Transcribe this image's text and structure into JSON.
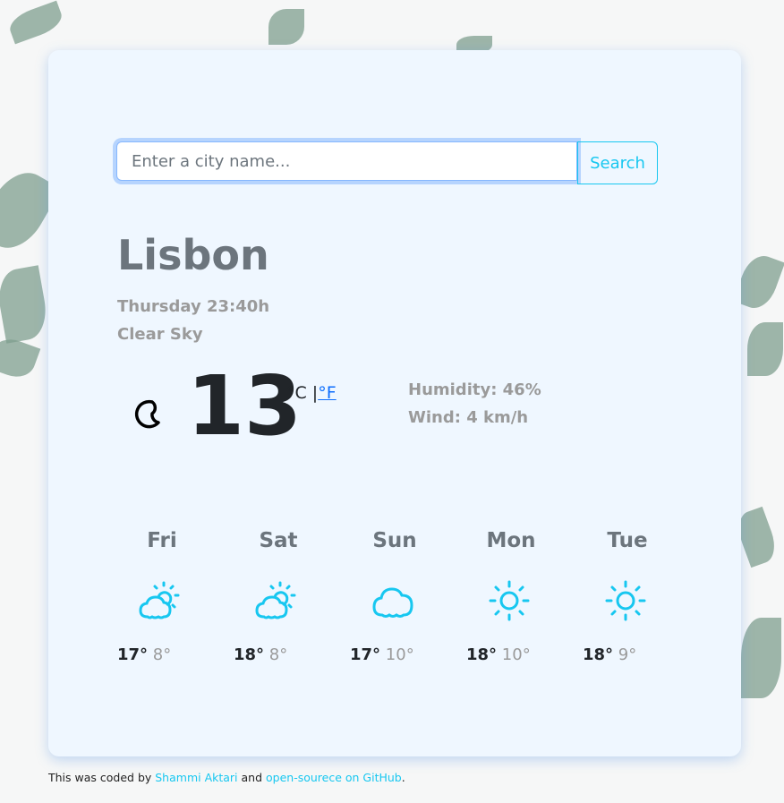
{
  "search": {
    "placeholder": "Enter a city name...",
    "button": "Search"
  },
  "city": "Lisbon",
  "datetime": "Thursday 23:40h",
  "description": "Clear Sky",
  "current": {
    "icon": "moon-icon",
    "temperature": "13",
    "unit_c": "°C |",
    "unit_f": "°F",
    "humidity": "Humidity: 46%",
    "wind": "Wind: 4 km/h"
  },
  "forecast": [
    {
      "day": "Fri",
      "icon": "partly-cloudy",
      "hi": "17°",
      "lo": "8°"
    },
    {
      "day": "Sat",
      "icon": "partly-cloudy",
      "hi": "18°",
      "lo": "8°"
    },
    {
      "day": "Sun",
      "icon": "cloud",
      "hi": "17°",
      "lo": "10°"
    },
    {
      "day": "Mon",
      "icon": "sun",
      "hi": "18°",
      "lo": "10°"
    },
    {
      "day": "Tue",
      "icon": "sun",
      "hi": "18°",
      "lo": "9°"
    }
  ],
  "footer": {
    "prefix": "This was coded by ",
    "author": "Shammi Aktari",
    "middle": " and ",
    "repo": "open-sourece on GitHub",
    "suffix": "."
  },
  "colors": {
    "accent": "#17c7f0",
    "card": "#eff7ff",
    "link": "#0d6efd"
  }
}
